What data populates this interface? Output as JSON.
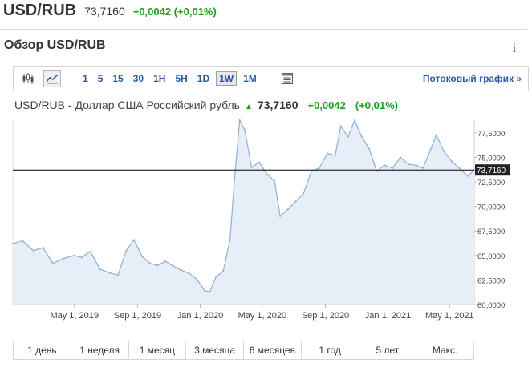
{
  "header": {
    "pair": "USD/RUB",
    "price": "73,7160",
    "change": "+0,0042 (+0,01%)"
  },
  "section": {
    "title": "Обзор USD/RUB",
    "info_icon": "info-icon"
  },
  "toolbar": {
    "chart_icons": [
      "candlestick-icon",
      "area-chart-icon"
    ],
    "ranges": [
      {
        "label": "1",
        "active": false
      },
      {
        "label": "5",
        "active": false
      },
      {
        "label": "15",
        "active": false
      },
      {
        "label": "30",
        "active": false
      },
      {
        "label": "1H",
        "active": false
      },
      {
        "label": "5H",
        "active": false
      },
      {
        "label": "1D",
        "active": false
      },
      {
        "label": "1W",
        "active": true
      },
      {
        "label": "1M",
        "active": false
      }
    ],
    "table_icon": "table-icon",
    "streaming_label": "Потоковый график",
    "streaming_arrow": "»"
  },
  "chart_title": {
    "name": "USD/RUB - Доллар США Российский рубль",
    "price": "73,7160",
    "change": "+0,0042",
    "pct": "(+0,01%)"
  },
  "colors": {
    "accent_blue": "#2c5aa0",
    "positive_green": "#1a9f1a",
    "line": "#8fb0d4",
    "fill": "#e6eef7"
  },
  "periods": [
    "1 день",
    "1 неделя",
    "1 месяц",
    "3 месяца",
    "6 месяцев",
    "1 год",
    "5 лет",
    "Макс."
  ],
  "chart_data": {
    "type": "area",
    "title": "USD/RUB - Доллар США Российский рубль",
    "xlabel": "",
    "ylabel": "",
    "ylim": [
      60.0,
      78.8
    ],
    "xlim": [
      "2019-01-01",
      "2021-06-18"
    ],
    "x_ticks": [
      {
        "date": "2019-05-01",
        "label": "May 1, 2019"
      },
      {
        "date": "2019-09-01",
        "label": "Sep 1, 2019"
      },
      {
        "date": "2020-01-01",
        "label": "Jan 1, 2020"
      },
      {
        "date": "2020-05-01",
        "label": "May 1, 2020"
      },
      {
        "date": "2020-09-01",
        "label": "Sep 1, 2020"
      },
      {
        "date": "2021-01-01",
        "label": "Jan 1, 2021"
      },
      {
        "date": "2021-05-01",
        "label": "May 1, 2021"
      }
    ],
    "y_ticks": [
      {
        "value": 77.5,
        "label": "77,5000"
      },
      {
        "value": 75.0,
        "label": "75,0000"
      },
      {
        "value": 72.5,
        "label": "72,5000"
      },
      {
        "value": 70.0,
        "label": "70,0000"
      },
      {
        "value": 67.5,
        "label": "67,5000"
      },
      {
        "value": 65.0,
        "label": "65,0000"
      },
      {
        "value": 62.5,
        "label": "62,5000"
      },
      {
        "value": 60.0,
        "label": "60,0000"
      }
    ],
    "current_value": 73.716,
    "current_label": "73,7160",
    "grid": false,
    "legend": "none",
    "series": [
      {
        "values": [
          {
            "x": "2019-01-01",
            "y": 66.2
          },
          {
            "x": "2019-01-20",
            "y": 66.5
          },
          {
            "x": "2019-02-10",
            "y": 65.5
          },
          {
            "x": "2019-03-01",
            "y": 65.8
          },
          {
            "x": "2019-03-20",
            "y": 64.2
          },
          {
            "x": "2019-04-10",
            "y": 64.7
          },
          {
            "x": "2019-05-01",
            "y": 65.0
          },
          {
            "x": "2019-05-15",
            "y": 64.8
          },
          {
            "x": "2019-06-01",
            "y": 65.4
          },
          {
            "x": "2019-06-20",
            "y": 63.6
          },
          {
            "x": "2019-07-10",
            "y": 63.2
          },
          {
            "x": "2019-07-25",
            "y": 63.0
          },
          {
            "x": "2019-08-10",
            "y": 65.5
          },
          {
            "x": "2019-08-25",
            "y": 66.6
          },
          {
            "x": "2019-09-10",
            "y": 64.9
          },
          {
            "x": "2019-09-25",
            "y": 64.2
          },
          {
            "x": "2019-10-10",
            "y": 64.0
          },
          {
            "x": "2019-10-25",
            "y": 64.4
          },
          {
            "x": "2019-11-10",
            "y": 63.9
          },
          {
            "x": "2019-11-25",
            "y": 63.5
          },
          {
            "x": "2019-12-10",
            "y": 63.2
          },
          {
            "x": "2019-12-25",
            "y": 62.6
          },
          {
            "x": "2020-01-10",
            "y": 61.4
          },
          {
            "x": "2020-01-20",
            "y": 61.3
          },
          {
            "x": "2020-02-01",
            "y": 62.8
          },
          {
            "x": "2020-02-15",
            "y": 63.4
          },
          {
            "x": "2020-02-28",
            "y": 66.6
          },
          {
            "x": "2020-03-08",
            "y": 72.8
          },
          {
            "x": "2020-03-18",
            "y": 79.5
          },
          {
            "x": "2020-03-28",
            "y": 77.8
          },
          {
            "x": "2020-04-10",
            "y": 74.0
          },
          {
            "x": "2020-04-25",
            "y": 74.5
          },
          {
            "x": "2020-05-10",
            "y": 73.3
          },
          {
            "x": "2020-05-25",
            "y": 72.6
          },
          {
            "x": "2020-06-05",
            "y": 69.0
          },
          {
            "x": "2020-06-20",
            "y": 69.7
          },
          {
            "x": "2020-07-05",
            "y": 70.5
          },
          {
            "x": "2020-07-20",
            "y": 71.3
          },
          {
            "x": "2020-08-05",
            "y": 73.6
          },
          {
            "x": "2020-08-20",
            "y": 73.9
          },
          {
            "x": "2020-09-05",
            "y": 75.4
          },
          {
            "x": "2020-09-20",
            "y": 75.2
          },
          {
            "x": "2020-10-01",
            "y": 78.2
          },
          {
            "x": "2020-10-15",
            "y": 77.1
          },
          {
            "x": "2020-10-28",
            "y": 79.0
          },
          {
            "x": "2020-11-10",
            "y": 77.2
          },
          {
            "x": "2020-11-25",
            "y": 75.9
          },
          {
            "x": "2020-12-10",
            "y": 73.6
          },
          {
            "x": "2020-12-25",
            "y": 74.2
          },
          {
            "x": "2021-01-10",
            "y": 73.9
          },
          {
            "x": "2021-01-25",
            "y": 75.0
          },
          {
            "x": "2021-02-10",
            "y": 74.3
          },
          {
            "x": "2021-02-25",
            "y": 74.2
          },
          {
            "x": "2021-03-10",
            "y": 73.9
          },
          {
            "x": "2021-03-25",
            "y": 75.8
          },
          {
            "x": "2021-04-05",
            "y": 77.3
          },
          {
            "x": "2021-04-20",
            "y": 75.6
          },
          {
            "x": "2021-05-05",
            "y": 74.6
          },
          {
            "x": "2021-05-20",
            "y": 73.9
          },
          {
            "x": "2021-06-05",
            "y": 73.1
          },
          {
            "x": "2021-06-18",
            "y": 73.7
          }
        ]
      }
    ]
  }
}
